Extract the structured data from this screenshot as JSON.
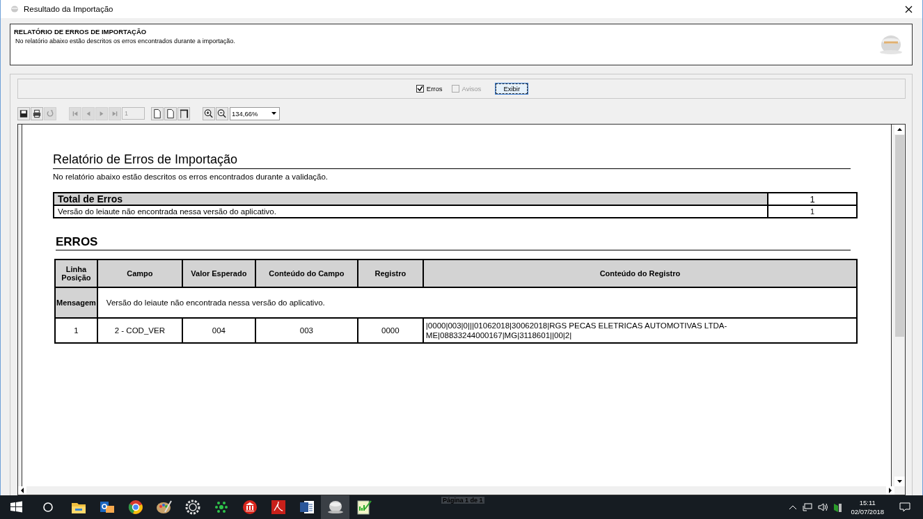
{
  "window": {
    "title": "Resultado da Importação"
  },
  "header": {
    "title": "RELATÓRIO DE ERROS DE IMPORTAÇÃO",
    "description": "No relatório abaixo estão descritos os erros encontrados durante a importação."
  },
  "filters": [
    {
      "label": "Erros",
      "checked": true,
      "disabled": false
    },
    {
      "label": "Avisos",
      "checked": false,
      "disabled": true
    }
  ],
  "show_button": "Exibir",
  "toolbar": {
    "buttons": [
      {
        "kind": "save",
        "disabled": false
      },
      {
        "kind": "print",
        "disabled": false
      },
      {
        "kind": "refresh",
        "disabled": true
      },
      {
        "kind": "first",
        "disabled": true
      },
      {
        "kind": "prev",
        "disabled": true
      },
      {
        "kind": "next",
        "disabled": true
      },
      {
        "kind": "last",
        "disabled": true
      },
      {
        "kind": "page",
        "disabled": false
      },
      {
        "kind": "page",
        "disabled": false
      },
      {
        "kind": "fullpage",
        "disabled": false
      },
      {
        "kind": "zoomin",
        "disabled": false
      },
      {
        "kind": "zoomout",
        "disabled": false
      }
    ],
    "page": "1",
    "zoom": "134,66%"
  },
  "report": {
    "title": "Relatório de Erros de Importação",
    "description": "No relatório abaixo estão descritos os erros encontrados durante a validação.",
    "totals": {
      "heading": "Total de Erros",
      "count": "1",
      "rows": [
        {
          "text": "Versão do leiaute não encontrada nessa versão do aplicativo.",
          "count": "1"
        }
      ]
    },
    "errors_heading": "ERROS",
    "columns": [
      "Linha Posição",
      "Campo",
      "Valor Esperado",
      "Conteúdo do Campo",
      "Registro",
      "Conteúdo do Registro"
    ],
    "message_label": "Mensagem",
    "message": "Versão do leiaute não encontrada nessa versão do aplicativo.",
    "rows": [
      {
        "cells": [
          "1",
          "2 - COD_VER",
          "004",
          "003",
          "0000",
          "|0000|003|0|||01062018|30062018|RGS PECAS ELETRICAS AUTOMOTIVAS LTDA-ME|08833244000167|MG|3118601||00|2|"
        ]
      }
    ]
  },
  "status": "Página 1 de 1",
  "taskbar": {
    "apps": [
      {
        "kind": "folder",
        "selected": false
      },
      {
        "kind": "mail",
        "selected": false
      },
      {
        "kind": "browser",
        "selected": false
      },
      {
        "kind": "palette",
        "selected": false
      },
      {
        "kind": "gear",
        "selected": false
      },
      {
        "kind": "dots",
        "selected": false
      },
      {
        "kind": "bank",
        "selected": false
      },
      {
        "kind": "pdf",
        "selected": false
      },
      {
        "kind": "word",
        "selected": false
      },
      {
        "kind": "globe",
        "selected": true
      },
      {
        "kind": "notepad",
        "selected": false
      }
    ],
    "time": "15:11",
    "date": "02/07/2018"
  }
}
